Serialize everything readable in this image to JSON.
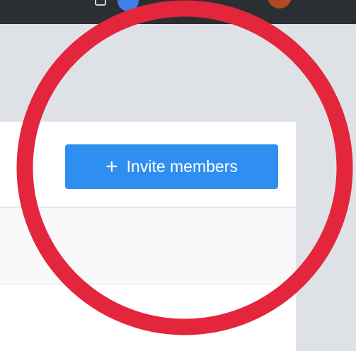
{
  "header": {
    "invite_button": {
      "icon": "plus-icon",
      "icon_glyph": "+",
      "label": "Invite members"
    }
  },
  "colors": {
    "topbar": "#2b2e33",
    "page_background": "#dee2e7",
    "card": "#ffffff",
    "button": "#2f8ff0",
    "annotation": "#e3263b"
  },
  "annotation": {
    "shape": "circle"
  }
}
